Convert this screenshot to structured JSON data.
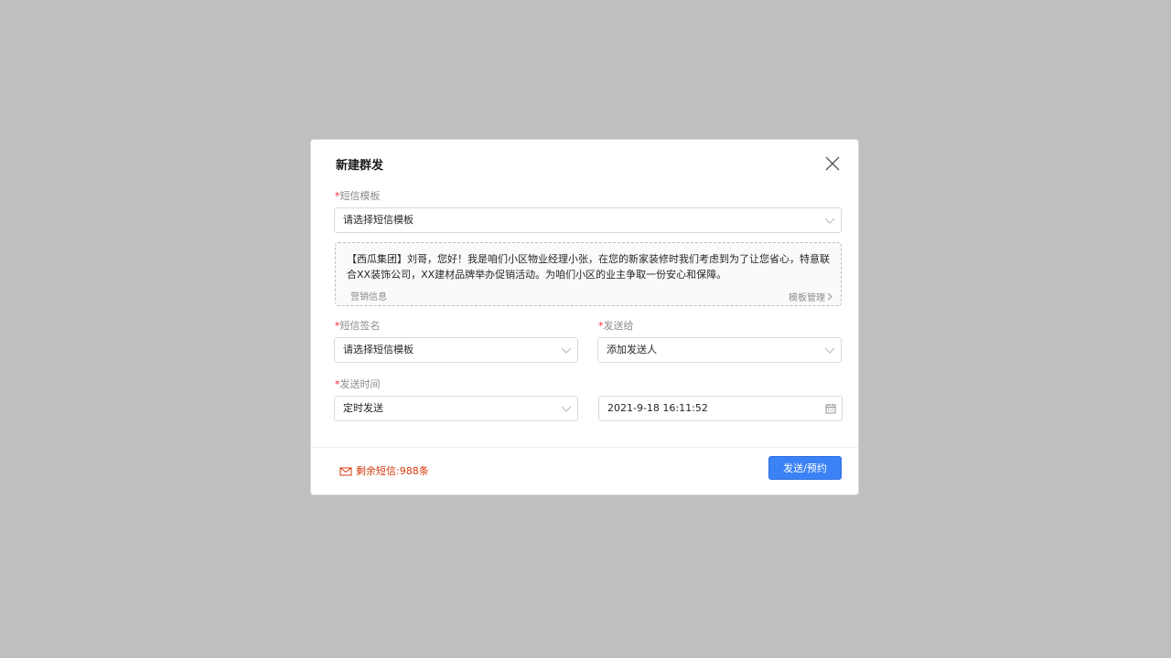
{
  "dialog": {
    "title": "新建群发",
    "close_icon": "close-icon"
  },
  "template": {
    "required_mark": "*",
    "label": "短信模板",
    "placeholder": "请选择短信模板"
  },
  "preview": {
    "text": "【西瓜集团】刘哥，您好！我是咱们小区物业经理小张，在您的新家装修时我们考虑到为了让您省心，特意联合XX装饰公司，XX建材品牌举办促销活动。为咱们小区的业主争取一份安心和保障。",
    "tag": "营销信息",
    "manage_link": "模板管理"
  },
  "signature": {
    "required_mark": "*",
    "label": "短信签名",
    "placeholder": "请选择短信模板"
  },
  "recipients": {
    "required_mark": "*",
    "label": "发送给",
    "placeholder": "添加发送人"
  },
  "send_time": {
    "required_mark": "*",
    "label": "发送时间",
    "mode": "定时发送",
    "datetime": "2021-9-18 16:11:52"
  },
  "footer": {
    "remaining": "剩余短信:988条",
    "send_button": "发送/预约"
  },
  "colors": {
    "accent": "#3b82f6",
    "required": "#f5222d",
    "warning_text": "#d4380d",
    "overlay": "#bfbfbf"
  }
}
